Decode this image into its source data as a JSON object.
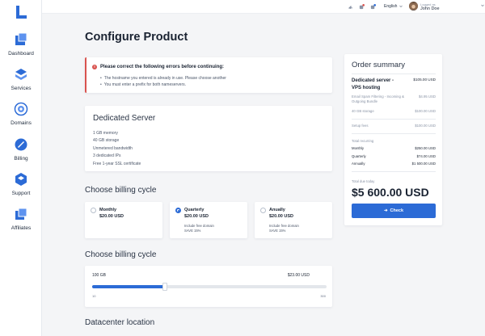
{
  "sidebar": {
    "items": [
      {
        "label": "Dashboard"
      },
      {
        "label": "Services"
      },
      {
        "label": "Domains"
      },
      {
        "label": "Billing"
      },
      {
        "label": "Support"
      },
      {
        "label": "Affiliates"
      }
    ]
  },
  "topbar": {
    "language": "English",
    "user_caption": "Logged as",
    "user_name": "John Doe"
  },
  "page": {
    "title": "Configure Product"
  },
  "alert": {
    "title": "Please correct the following errors before continuing:",
    "errors": [
      "The hostname you entered is already in use. Please choose another",
      "You must enter a prefix for both nameservers."
    ]
  },
  "product": {
    "name": "Dedicated Server",
    "features": [
      "1 GB memory",
      "40 GB storage",
      "Unmetered bandwidth",
      "3 dedicated IPs",
      "Free 1-year SSL certificate"
    ]
  },
  "billing_cycle": {
    "title": "Choose billing cycle",
    "options": [
      {
        "name": "Monthly",
        "price": "$20.00 USD",
        "note1": "",
        "note2": "",
        "selected": false
      },
      {
        "name": "Quarterly",
        "price": "$20.00 USD",
        "note1": "Include free domain",
        "note2": "SAVE 15%",
        "selected": true
      },
      {
        "name": "Anually",
        "price": "$20.00 USD",
        "note1": "Include free domain",
        "note2": "SAVE 15%",
        "selected": false
      }
    ]
  },
  "slider_section": {
    "title": "Choose billing cycle",
    "value_label": "100 GB",
    "price_label": "$23.00 USD",
    "min_label": "10",
    "max_label": "300",
    "min": 10,
    "max": 300,
    "value": 100
  },
  "datacenter": {
    "title": "Datacenter location"
  },
  "summary": {
    "title": "Order summary",
    "product_name": "Dedicated server - VPS hosting",
    "product_price": "$105.00 USD",
    "addons": [
      {
        "label": "Email Spam Filtering - Incoming & Outgoing Bundle",
        "value": "$4.95 USD"
      },
      {
        "label": "40 GB storage",
        "value": "$100.00 USD"
      }
    ],
    "setup_label": "Setup fees",
    "setup_value": "$100.00 USD",
    "recurring_label": "Total recurring",
    "recurring": [
      {
        "label": "Monthly",
        "value": "$250.00 USD"
      },
      {
        "label": "Quarterly",
        "value": "$74.00 USD"
      },
      {
        "label": "Annually",
        "value": "$1 500.00 USD"
      }
    ],
    "due_label": "Total due today",
    "due_value": "$5 600.00 USD",
    "check_label": "Check"
  },
  "colors": {
    "accent": "#2c6bd6",
    "error": "#d9534f",
    "background": "#f4f5f7"
  },
  "icons": {
    "logo": "brand-logo-icon",
    "dashboard": "dashboard-cube-icon",
    "services": "services-layers-icon",
    "domains": "globe-icon",
    "billing": "billing-card-icon",
    "support": "support-icon",
    "affiliates": "affiliates-icon",
    "topbar": [
      "share-icon",
      "notifications-icon",
      "cart-icon"
    ]
  }
}
